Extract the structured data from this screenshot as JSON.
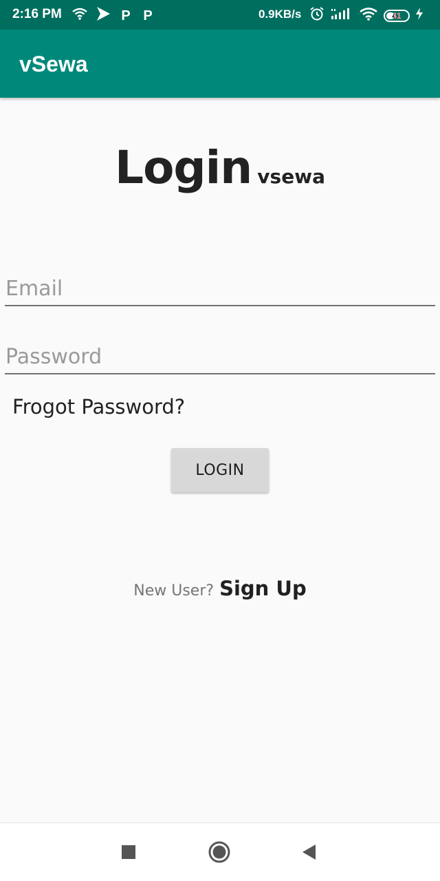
{
  "status_bar": {
    "time": "2:16 PM",
    "p_icon_1": "P",
    "p_icon_2": "P",
    "network_speed": "0.9KB/s",
    "battery_level": "41",
    "battery_fraction": 0.41,
    "icons": [
      "wifi-icon",
      "play-icon",
      "alarm-icon",
      "signal-icon",
      "charging-icon"
    ]
  },
  "app_bar": {
    "title": "vSewa"
  },
  "heading": {
    "main": "Login",
    "sub": "vsewa"
  },
  "form": {
    "email_placeholder": "Email",
    "email_value": "",
    "password_placeholder": "Password",
    "password_value": "",
    "forgot_label": "Frogot Password?",
    "login_label": "LOGIN"
  },
  "signup": {
    "prompt": "New User?",
    "link": "Sign Up"
  },
  "nav_bar": {
    "icons": [
      "recents-icon",
      "home-icon",
      "back-icon"
    ]
  },
  "colors": {
    "status_bar": "#006e5f",
    "app_bar": "#00897b",
    "background": "#fafafa",
    "button": "#d8d8d8"
  }
}
